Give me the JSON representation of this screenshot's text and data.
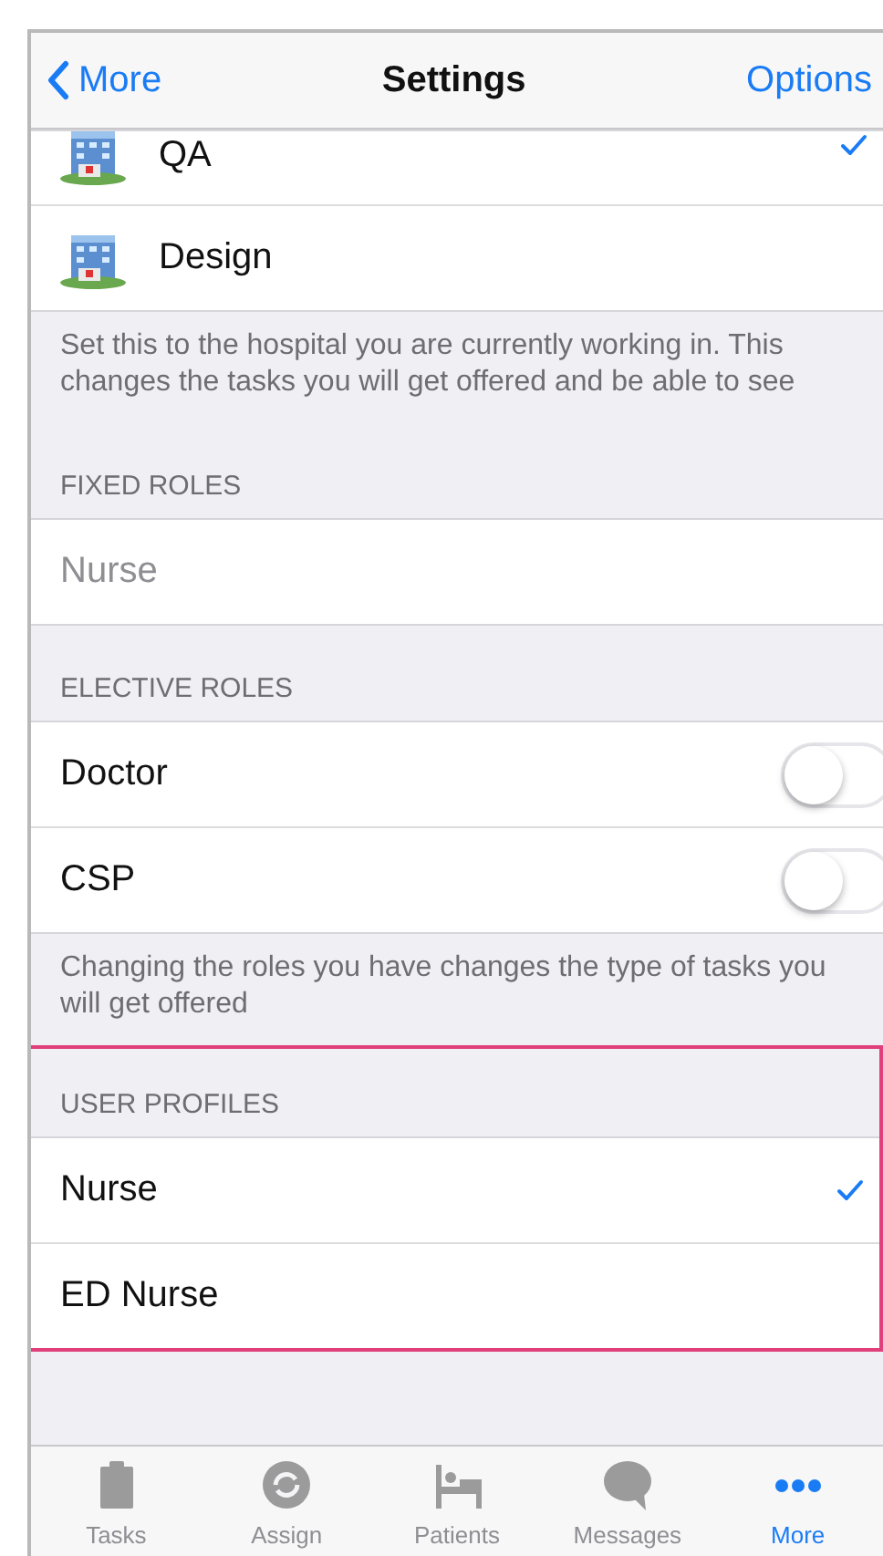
{
  "nav": {
    "back": "More",
    "title": "Settings",
    "action": "Options"
  },
  "hospitals": [
    {
      "name": "QA",
      "selected": true
    },
    {
      "name": "Design",
      "selected": false
    }
  ],
  "hospitals_footer": "Set this to the hospital you are currently working in. This changes the tasks you will get offered and be able to see",
  "fixed_roles": {
    "header": "FIXED ROLES",
    "items": [
      {
        "name": "Nurse",
        "disabled": true
      }
    ]
  },
  "elective_roles": {
    "header": "ELECTIVE ROLES",
    "items": [
      {
        "name": "Doctor",
        "on": false
      },
      {
        "name": "CSP",
        "on": false
      }
    ],
    "footer": "Changing the roles you have changes the type of tasks you will get offered"
  },
  "user_profiles": {
    "header": "USER PROFILES",
    "highlighted": true,
    "items": [
      {
        "name": "Nurse",
        "selected": true
      },
      {
        "name": "ED Nurse",
        "selected": false
      }
    ]
  },
  "tab_bar": [
    {
      "kind": "clipboard",
      "label": "Tasks",
      "selected": false
    },
    {
      "kind": "cycle",
      "label": "Assign",
      "selected": false
    },
    {
      "kind": "bed",
      "label": "Patients",
      "selected": false
    },
    {
      "kind": "bubble",
      "label": "Messages",
      "selected": false
    },
    {
      "kind": "dots",
      "label": "More",
      "selected": true
    }
  ]
}
